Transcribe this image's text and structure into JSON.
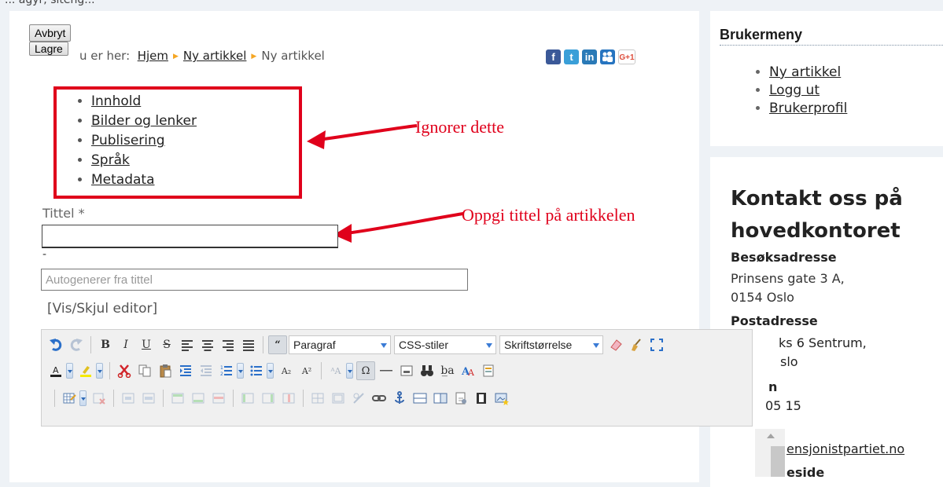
{
  "header_fragment": "... agyr, siteng...",
  "form": {
    "cancel_label": "Avbryt",
    "save_label": "Lagre",
    "title_label": "Tittel *",
    "title_value": "",
    "dash": "-",
    "alias_placeholder": "Autogenerer fra tittel",
    "toggle_editor": "[Vis/Skjul editor]"
  },
  "breadcrumb": {
    "prefix": "u er her:",
    "items": [
      "Hjem",
      "Ny artikkel",
      "Ny artikkel"
    ]
  },
  "social": [
    "f",
    "t",
    "in",
    "ms",
    "G+1"
  ],
  "tabs": [
    "Innhold",
    "Bilder og lenker",
    "Publisering",
    "Språk",
    "Metadata"
  ],
  "annotations": {
    "ignore": "Ignorer dette",
    "title_hint": "Oppgi tittel på artikkelen",
    "color": "#e0001b"
  },
  "editor": {
    "format_value": "Paragraf",
    "styles_value": "CSS-stiler",
    "fontsize_value": "Skriftstørrelse"
  },
  "user_menu": {
    "title": "Brukermeny",
    "items": [
      "Ny artikkel",
      "Logg ut",
      "Brukerprofil"
    ]
  },
  "contact": {
    "title": "Kontakt oss på hovedkontoret",
    "visit_heading": "Besøksadresse",
    "visit_line1": "Prinsens gate 3 A,",
    "visit_line2": "0154 Oslo",
    "post_heading": "Postadresse",
    "post_line1_fragment": "ks 6 Sentrum,",
    "post_line2_fragment": "slo",
    "frag_n": "n",
    "frag_phone": "05 15",
    "frag_email": "ensjonistpartiet.no",
    "frag_web": "eside"
  }
}
